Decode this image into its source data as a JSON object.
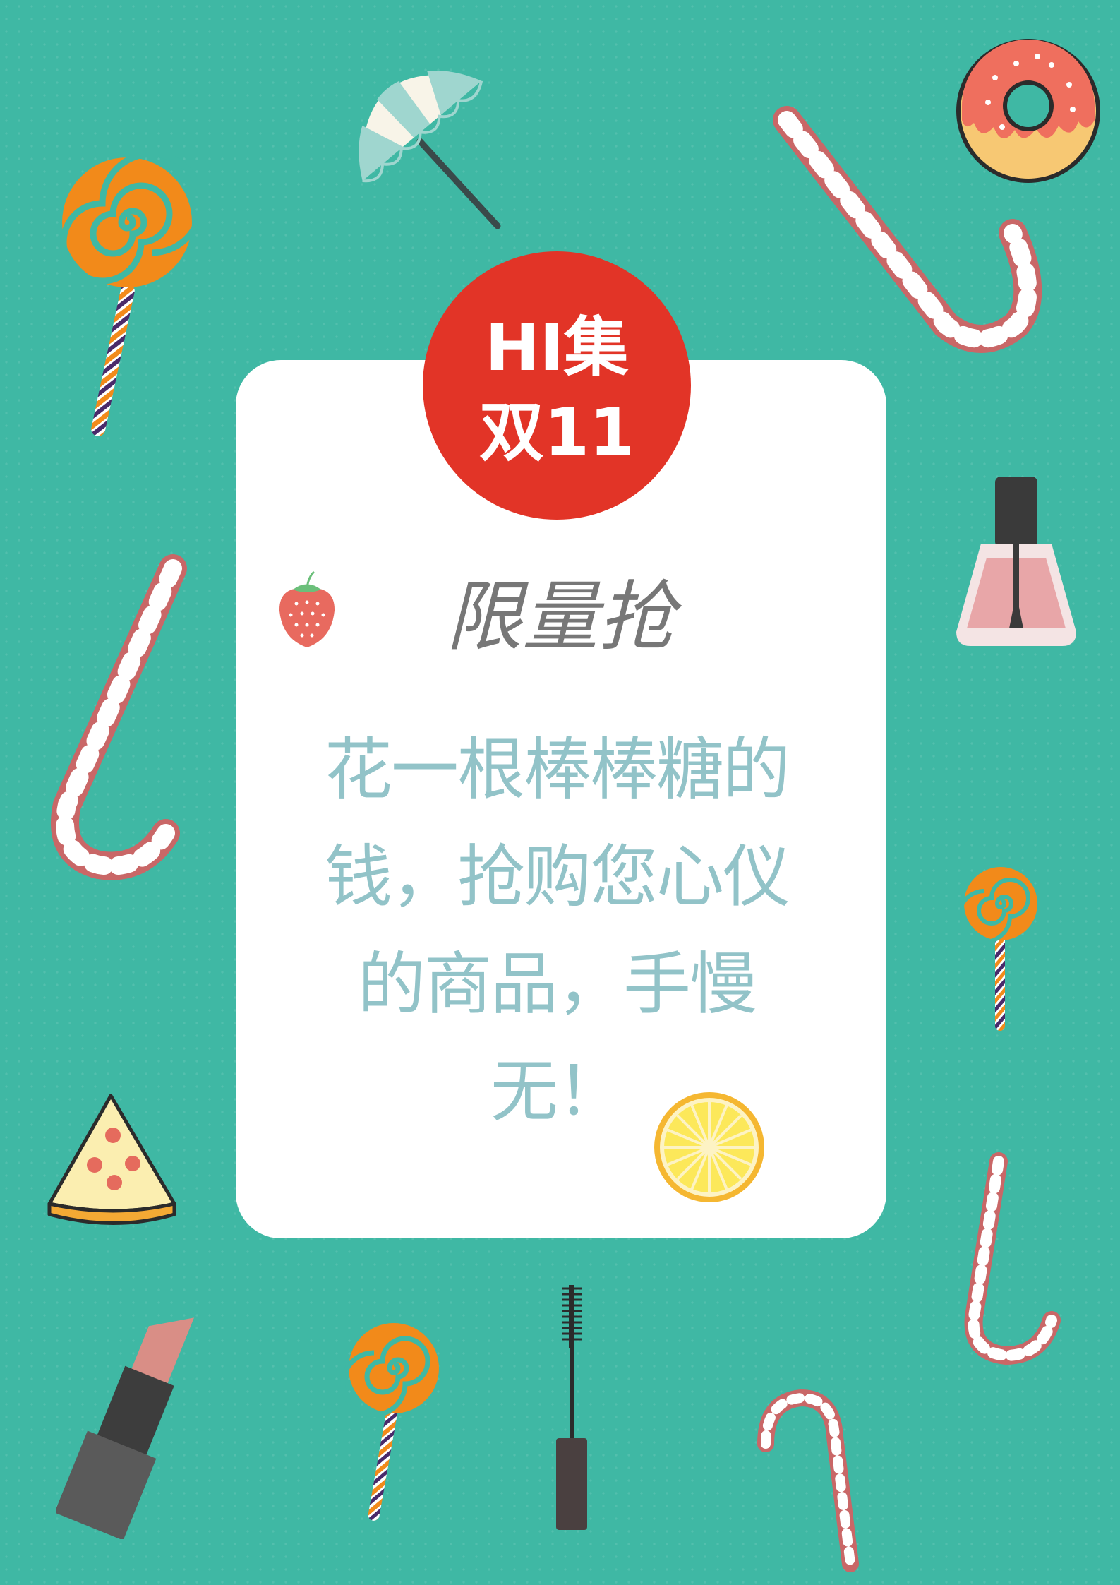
{
  "badge": {
    "line1": "HI集",
    "line2": "双11"
  },
  "headline": "限量抢",
  "body_text": "花一根棒棒糖的钱，抢购您心仪的商品，手慢无！",
  "colors": {
    "background": "#3fb8a4",
    "card": "#ffffff",
    "badge": "#e23427",
    "headline": "#777777",
    "body_text": "#92c3c8"
  },
  "decorations": [
    "umbrella-icon",
    "donut-icon",
    "lollipop-icon",
    "candy-cane-icon",
    "nail-polish-icon",
    "strawberry-icon",
    "lemon-slice-icon",
    "pizza-slice-icon",
    "lipstick-icon",
    "mascara-icon"
  ]
}
